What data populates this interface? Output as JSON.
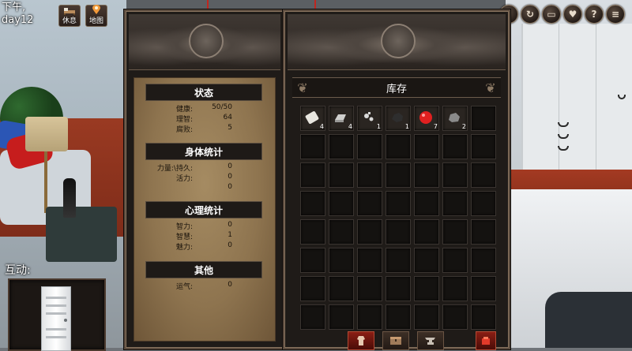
{
  "hud": {
    "time_of_day": "下午,",
    "day": "day12",
    "rest_label": "休息",
    "map_label": "地图"
  },
  "top_icons": [
    "question-mark-icon",
    "refresh-icon",
    "book-icon",
    "heart-icon",
    "help-icon",
    "menu-icon"
  ],
  "top_icon_glyphs": [
    "?",
    "↻",
    "▭",
    "♥",
    "?",
    "≡"
  ],
  "interaction": {
    "label": "互动:"
  },
  "stats": {
    "status_title": "状态",
    "health_label": "健康:",
    "health_value": "50/50",
    "sanity_label": "理智:",
    "sanity_value": "64",
    "corruption_label": "腐败:",
    "corruption_value": "5",
    "body_title": "身体统计",
    "strength_label": "力量:\\持久:",
    "strength_value": "0",
    "vitality_label": "活力:",
    "vitality_value": "0",
    "extra_value": "0",
    "mind_title": "心理统计",
    "intellect_label": "智力:",
    "intellect_value": "0",
    "wisdom_label": "智慧:",
    "wisdom_value": "1",
    "charm_label": "魅力:",
    "charm_value": "0",
    "other_title": "其他",
    "luck_label": "运气:",
    "luck_value": "0"
  },
  "inventory": {
    "title": "库存",
    "items": [
      {
        "name": "paper-scroll",
        "count": "4"
      },
      {
        "name": "metal-ingot",
        "count": "4"
      },
      {
        "name": "scrap-parts",
        "count": "1"
      },
      {
        "name": "coal-lump",
        "count": "1"
      },
      {
        "name": "red-orb",
        "count": "7"
      },
      {
        "name": "stone",
        "count": "2"
      }
    ],
    "colors": {
      "paper-scroll": "#e8e6df",
      "metal-ingot": "#cfcfcd",
      "scrap-parts": "#d9d9d9",
      "coal-lump": "#2e2e2e",
      "red-orb": "#e02020",
      "stone": "#8a8a8a"
    }
  },
  "bottom_tabs": [
    "torso-icon",
    "chest-icon",
    "anvil-icon",
    "red-bag-icon"
  ]
}
